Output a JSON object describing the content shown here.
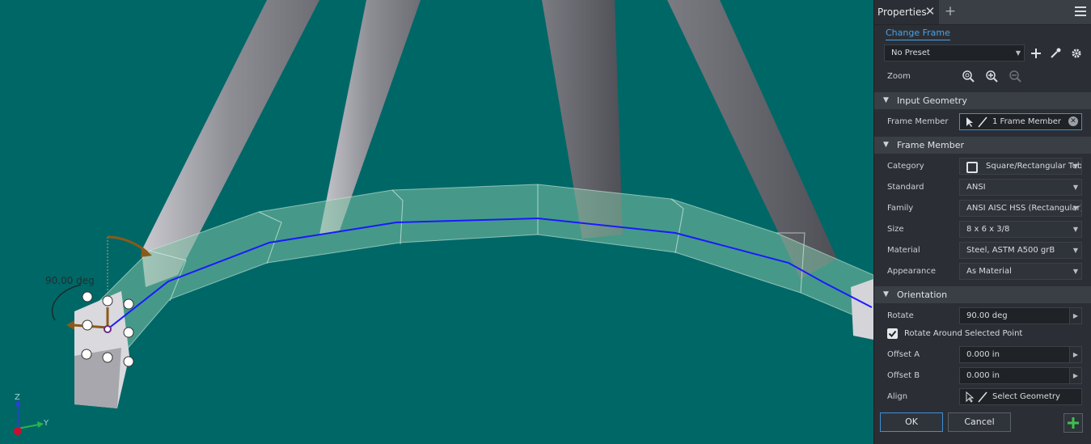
{
  "viewport": {
    "angle_label": "90.00 deg",
    "axis_z": "Z",
    "axis_y": "Y"
  },
  "panel": {
    "tab_title": "Properties",
    "change_frame_label": "Change Frame",
    "preset_value": "No Preset",
    "zoom_label": "Zoom",
    "sections": {
      "input_geometry": "Input Geometry",
      "frame_member": "Frame Member",
      "orientation": "Orientation"
    },
    "input_geometry": {
      "frame_member_label": "Frame Member",
      "frame_member_value": "1 Frame Member"
    },
    "frame_member": {
      "category_label": "Category",
      "category_value": "Square/Rectangular Tub",
      "standard_label": "Standard",
      "standard_value": "ANSI",
      "family_label": "Family",
      "family_value": "ANSI AISC HSS (Rectangular) -",
      "size_label": "Size",
      "size_value": "8 x 6 x 3/8",
      "material_label": "Material",
      "material_value": "Steel, ASTM A500 grB",
      "appearance_label": "Appearance",
      "appearance_value": "As Material"
    },
    "orientation": {
      "rotate_label": "Rotate",
      "rotate_value": "90.00 deg",
      "rotate_point_label": "Rotate Around Selected Point",
      "rotate_point_checked": true,
      "offset_a_label": "Offset A",
      "offset_a_value": "0.000 in",
      "offset_b_label": "Offset B",
      "offset_b_value": "0.000 in",
      "align_label": "Align",
      "align_value": "Select Geometry"
    },
    "buttons": {
      "ok": "OK",
      "cancel": "Cancel"
    }
  }
}
